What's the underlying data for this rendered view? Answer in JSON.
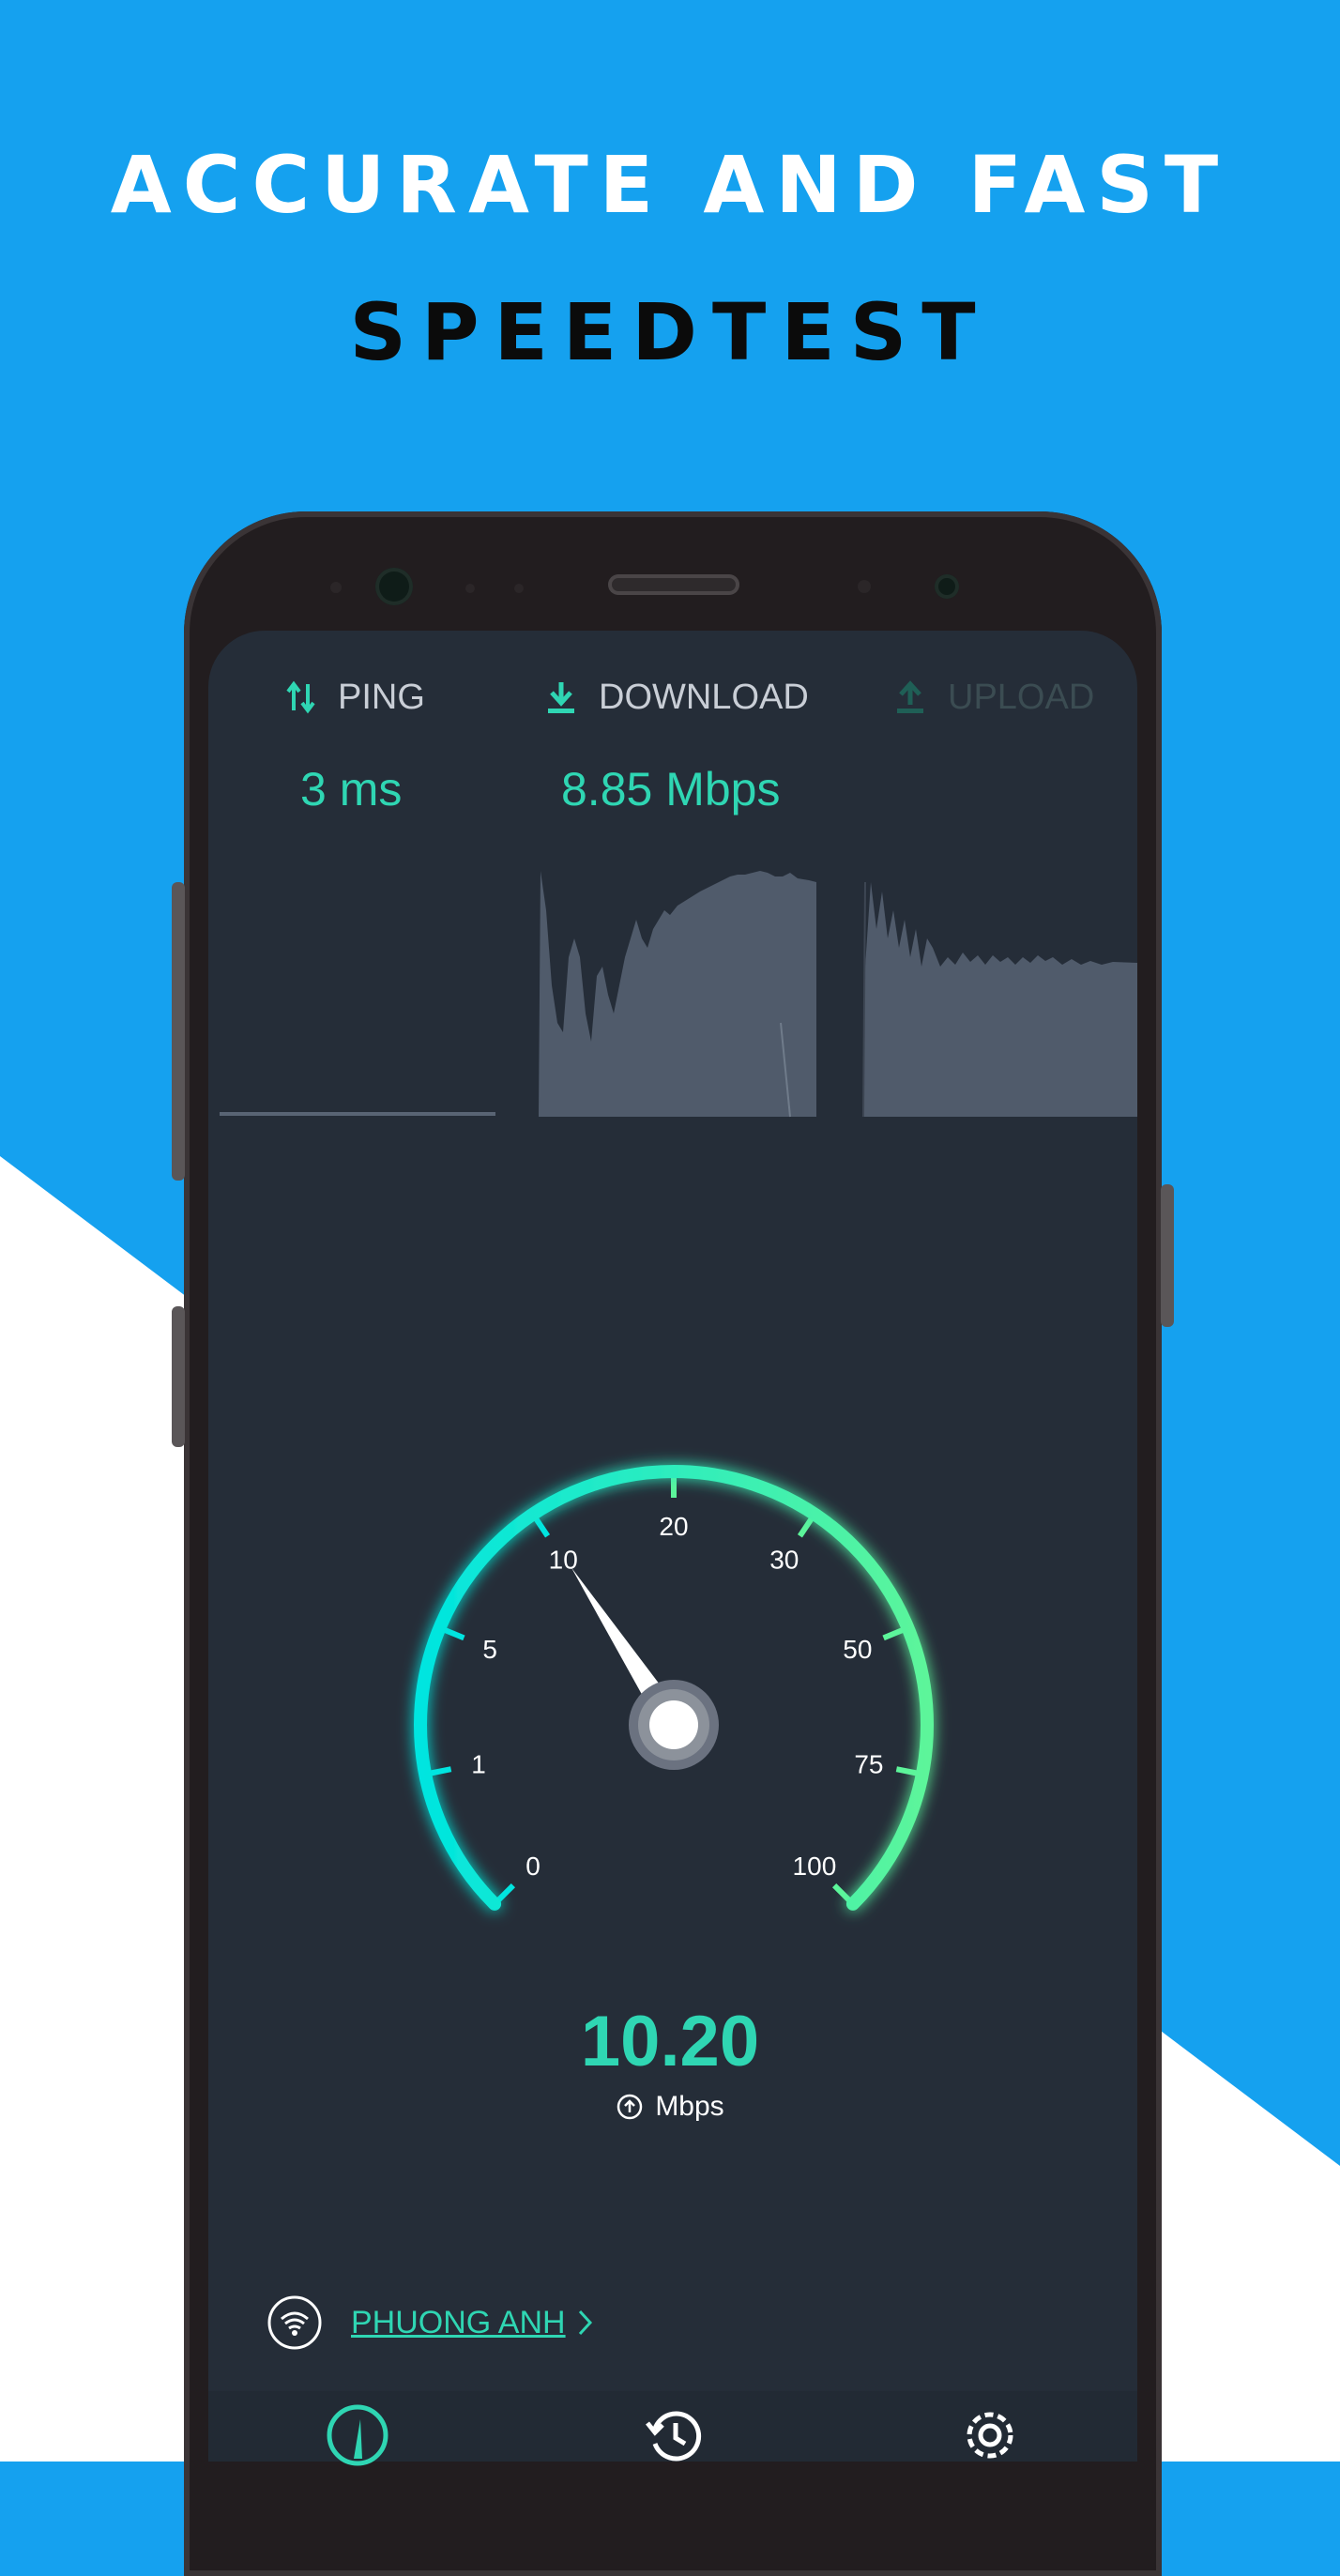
{
  "headline": {
    "line1": "ACCURATE AND FAST",
    "line2": "SPEEDTEST"
  },
  "tabs": [
    {
      "label": "PING",
      "icon": "ping-arrows-icon",
      "value": "3 ms"
    },
    {
      "label": "DOWNLOAD",
      "icon": "download-icon",
      "value": "8.85 Mbps"
    },
    {
      "label": "UPLOAD",
      "icon": "upload-icon"
    }
  ],
  "gauge": {
    "ticks": [
      "0",
      "1",
      "5",
      "10",
      "20",
      "30",
      "50",
      "75",
      "100"
    ],
    "needle_value": 10.2
  },
  "speed": {
    "value": "10.20",
    "unit": "Mbps"
  },
  "network": {
    "name": "PHUONG ANH"
  },
  "nav": [
    "speedometer-icon",
    "history-icon",
    "settings-gear-icon"
  ],
  "colors": {
    "background_blue": "#15a1ef",
    "accent": "#2fd6b3",
    "screen": "#252d38",
    "gauge_start": "#00e5e0",
    "gauge_end": "#5df59a"
  }
}
